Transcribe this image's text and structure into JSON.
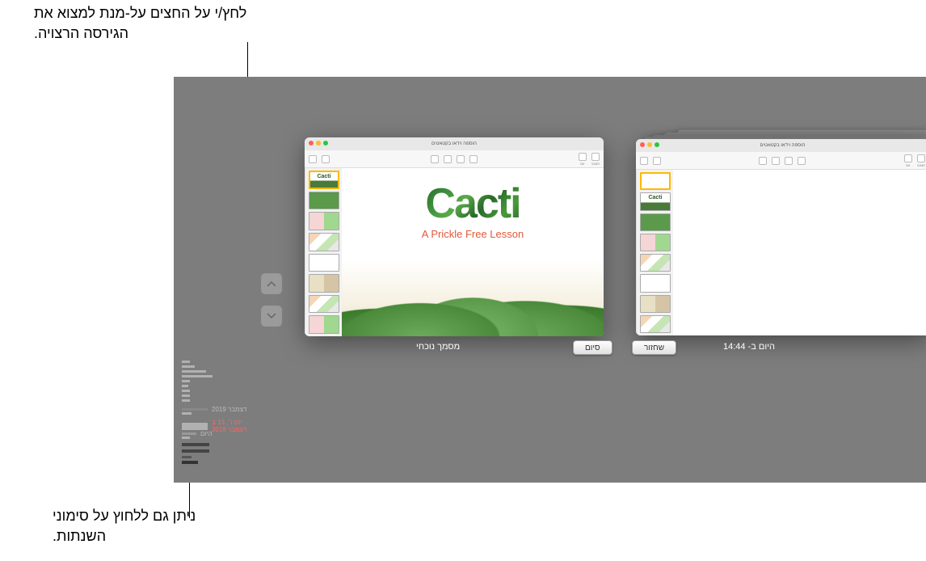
{
  "callouts": {
    "top": "לחץ/י על החצים על-מנת למצוא את הגירסה הרצויה.",
    "bottom": "ניתן גם ללחוץ על סימוני השנתות."
  },
  "current_window": {
    "title": "מסמך נוכחי",
    "doc_title": "Cacti",
    "doc_subtitle": "A Prickle Free Lesson",
    "toolbar_label": "הוספה וידאו בקטאטים"
  },
  "past_window": {
    "timestamp": "היום ב- 14:44",
    "toolbar_label": "הוספה וידאו בקטאטים"
  },
  "buttons": {
    "done": "סיום",
    "restore": "שחזור"
  },
  "timeline": {
    "month_label": "דצמבר 2019",
    "selected_label": "יום ו׳, 13 ב דצמבר 2019",
    "today_label": "היום"
  },
  "thumbnails": {
    "cacti_text": "Cacti"
  }
}
